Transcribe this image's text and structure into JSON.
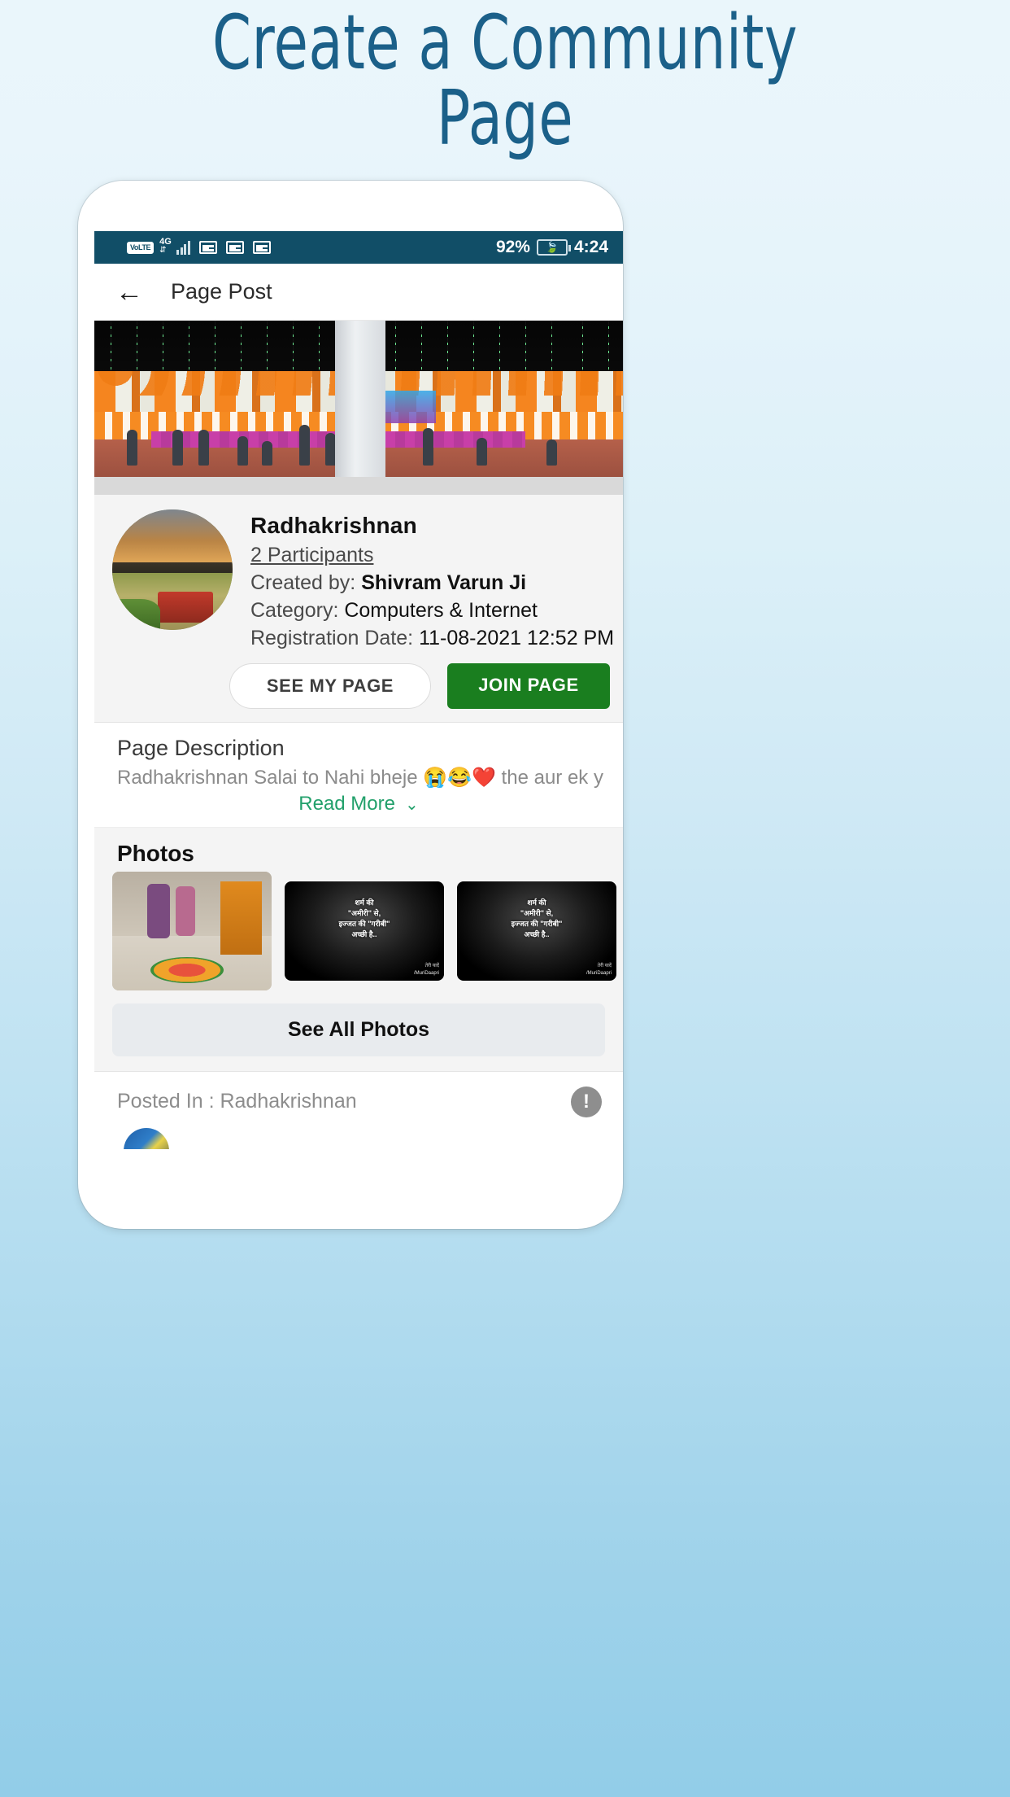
{
  "headline": "Create a Community\nPage",
  "theme": {
    "headline_color": "#1b6089",
    "statusbar_bg": "#114e67",
    "accent_green": "#1a7e1f",
    "link_green": "#22a06b",
    "page_bg_top": "#eaf6fb",
    "page_bg_bottom": "#92cde8"
  },
  "statusbar": {
    "volte": "VoLTE",
    "network": "4G",
    "battery_percent": "92%",
    "time": "4:24",
    "icons": [
      "volte-icon",
      "signal-bars-icon",
      "sim-card-icon",
      "sim-card-icon",
      "sim-card-icon",
      "battery-icon"
    ]
  },
  "appbar": {
    "back_icon": "back-arrow-icon",
    "title": "Page Post"
  },
  "page": {
    "cover_photo_alt": "decorated event venue cover photo",
    "name": "Radhakrishnan",
    "participants": "2 Participants",
    "created_by_label": "Created by:",
    "created_by_value": "Shivram Varun Ji",
    "category_label": "Category:",
    "category_value": "Computers & Internet",
    "registration_label": "Registration Date:",
    "registration_value": "11-08-2021 12:52 PM",
    "see_my_page_button": "SEE MY PAGE",
    "join_page_button": "JOIN PAGE"
  },
  "description": {
    "heading": "Page Description",
    "text": "Radhakrishnan Salai to Nahi bheje 😭😂❤️ the aur ek y",
    "read_more": "Read More",
    "chevron": "chevron-down-icon"
  },
  "photos": {
    "heading": "Photos",
    "items": [
      {
        "type": "room-photo",
        "alt": "indoor room with floral rangoli"
      },
      {
        "type": "quote-photo",
        "quote": "शर्म की\n\"अमीरी\" से,\nइज्जत की \"गरीबी\"\nअच्छी है..",
        "brand": "तेरी यादें",
        "handle": "/MuriDaapri"
      },
      {
        "type": "quote-photo",
        "quote": "शर्म की\n\"अमीरी\" से,\nइज्जत की \"गरीबी\"\nअच्छी है..",
        "brand": "तेरी यादें",
        "handle": "/MuriDaapri"
      }
    ],
    "see_all_button": "See All Photos"
  },
  "posted": {
    "label": "Posted In : Radhakrishnan",
    "info_icon": "exclamation-icon",
    "avatar_alt": "post author avatar"
  },
  "navbar": {
    "back_icon": "nav-back-triangle-icon",
    "home_icon": "nav-home-circle-icon",
    "recents_icon": "nav-recents-square-icon"
  }
}
